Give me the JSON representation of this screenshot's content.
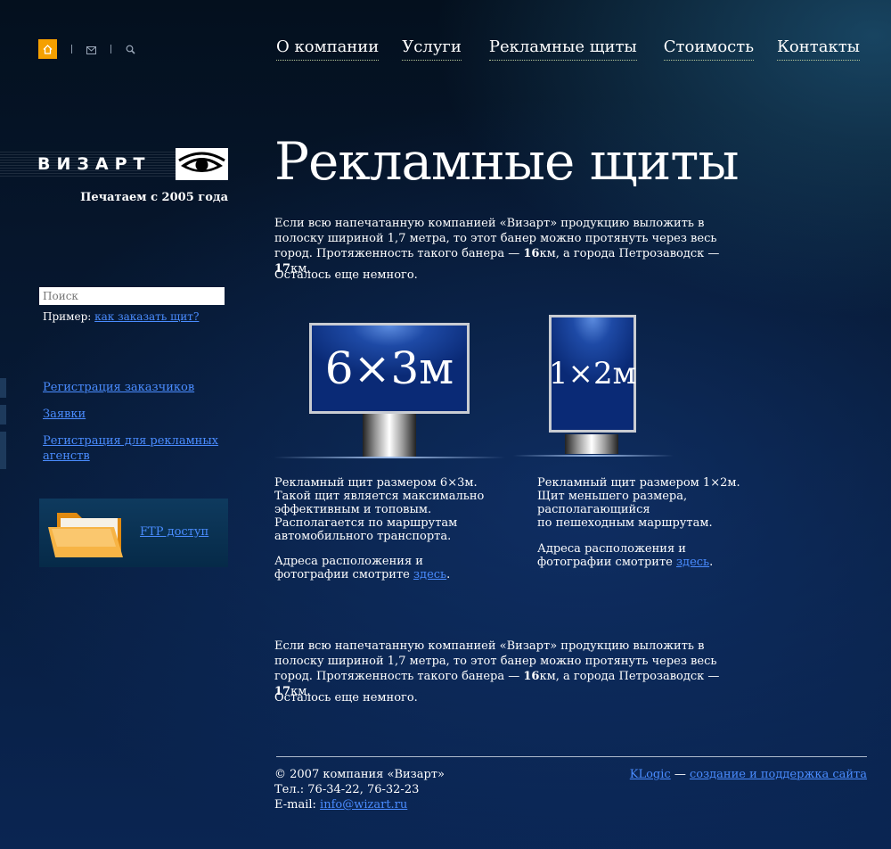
{
  "top_icons": [
    "home-icon",
    "mail-icon",
    "search-icon"
  ],
  "nav": [
    {
      "label": "О компании"
    },
    {
      "label": "Услуги"
    },
    {
      "label": "Рекламные щиты"
    },
    {
      "label": "Стоимость"
    },
    {
      "label": "Контакты"
    }
  ],
  "logo": {
    "text": "ВИЗАРТ",
    "tagline": "Печатаем с 2005 года"
  },
  "page": {
    "title": "Рекламные щиты"
  },
  "intro": {
    "line1": "Если всю напечатанную компанией «Визарт» продукцию выложить в полоску шириной 1,7 метра, то этот банер можно протянуть через весь город. Протяженность такого банера — ",
    "num1": "16",
    "mid": "км, а города Петрозаводск — ",
    "num2": "17",
    "end": "км.",
    "remain": "Осталось еще немного."
  },
  "search": {
    "placeholder": "Поиск",
    "example_label": "Пример:",
    "example_link": "как заказать щит?"
  },
  "side_links": [
    "Регистрация заказчиков",
    "Заявки",
    "Регистрация для рекламных агенств"
  ],
  "ftp": {
    "label": "FTP доступ"
  },
  "boards": [
    {
      "size_label": "6×3м",
      "desc_lines": [
        "Рекламный щит размером 6×3м.",
        "Такой щит является максимально",
        "эффективным и топовым.",
        "Располагается по маршрутам",
        "автомобильного транспорта."
      ],
      "addr_text": "Адреса расположения и фотографии смотрите ",
      "addr_link": "здесь",
      "addr_end": "."
    },
    {
      "size_label": "1×2м",
      "desc_lines": [
        "Рекламный щит размером 1×2м.",
        "Щит меньшего размера, располагающийся",
        "по пешеходным маршрутам."
      ],
      "addr_text": "Адреса расположения и фотографии смотрите ",
      "addr_link": "здесь",
      "addr_end": "."
    }
  ],
  "footer": {
    "copyright": "© 2007 компания «Визарт»",
    "phone_label": "Тел.:",
    "phone": "76-34-22, 76-32-23",
    "email_label": "E-mail:",
    "email": "info@wizart.ru",
    "dev_link": "KLogic",
    "dev_sep": " — ",
    "dev_text": "создание и поддержка сайта"
  },
  "colors": {
    "accent": "#f5a000",
    "link": "#4a8cff"
  }
}
